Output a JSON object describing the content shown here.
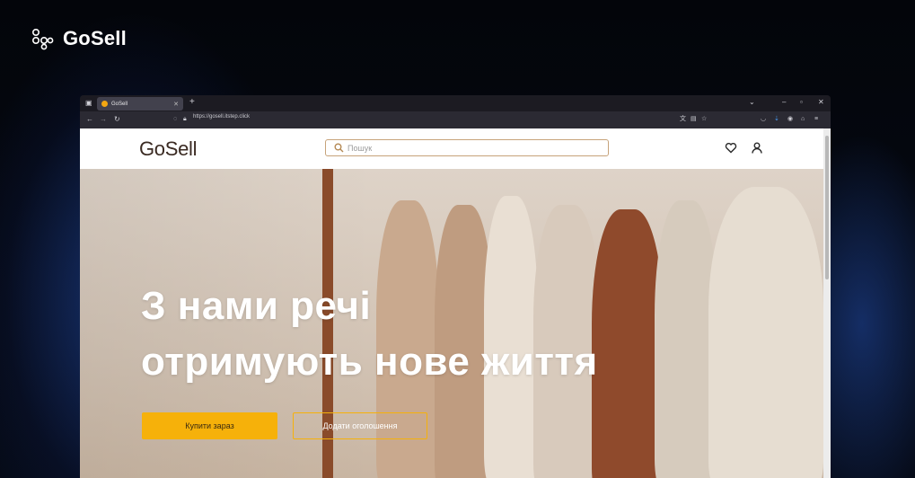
{
  "brand": {
    "name": "GoSell",
    "icon": "gosell-logo-icon"
  },
  "browser": {
    "tab_title": "GoSell",
    "url": "https://gosell.itstep.click",
    "new_tab": "+",
    "window_controls": [
      "⌄",
      "–",
      "▫",
      "✕"
    ]
  },
  "site": {
    "logo": "GoSell",
    "search_placeholder": "Пошук",
    "hero": {
      "line1": "З нами речі",
      "line2": "отримують нове життя"
    },
    "buy_button": "Купити зараз",
    "add_button": "Додати оголошення"
  },
  "colors": {
    "accent": "#f6b10a",
    "logo": "#3a2a22",
    "search_border": "#c7a37a"
  }
}
